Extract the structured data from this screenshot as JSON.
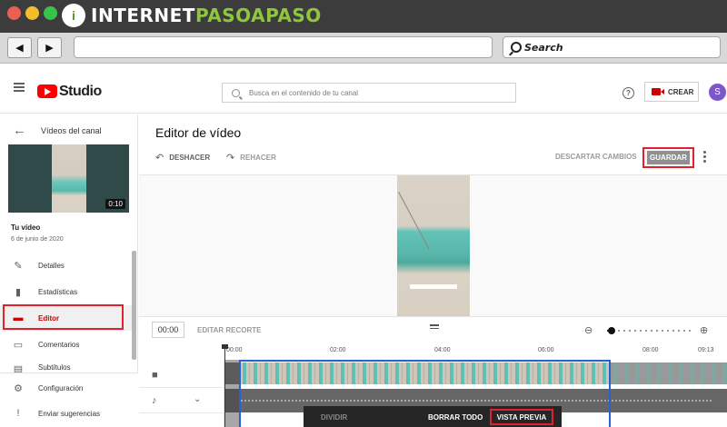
{
  "browser": {
    "brand_a": "INTERNET",
    "brand_b": "PASOAPASO",
    "brand_logo_letter": "i",
    "search_placeholder": "Search",
    "back_glyph": "◀",
    "forward_glyph": "▶"
  },
  "header": {
    "app_name": "Studio",
    "search_placeholder": "Busca en el contenido de tu canal",
    "help_glyph": "?",
    "create_label": "CREAR",
    "avatar_letter": "S"
  },
  "sidebar": {
    "back_label": "Vídeos del canal",
    "thumbnail_duration": "0:10",
    "video_title": "Tu vídeo",
    "video_date": "6 de junio de 2020",
    "items": [
      {
        "label": "Detalles",
        "icon": "pencil-icon"
      },
      {
        "label": "Estadísticas",
        "icon": "bar-chart-icon"
      },
      {
        "label": "Editor",
        "icon": "clapperboard-icon",
        "active": true
      },
      {
        "label": "Comentarios",
        "icon": "comment-icon"
      },
      {
        "label": "Subtítulos",
        "icon": "subtitles-icon"
      }
    ],
    "bottom_items": [
      {
        "label": "Configuración",
        "icon": "gear-icon"
      },
      {
        "label": "Enviar sugerencias",
        "icon": "feedback-icon"
      }
    ]
  },
  "editor": {
    "title": "Editor de vídeo",
    "undo_label": "DESHACER",
    "redo_label": "REHACER",
    "discard_label": "DESCARTAR CAMBIOS",
    "save_label": "GUARDAR"
  },
  "timeline": {
    "current_time": "00:00",
    "edit_trim_label": "EDITAR RECORTE",
    "ticks": [
      "00:00",
      "02:00",
      "04:00",
      "06:00",
      "08:00",
      "09:13"
    ],
    "zoom_level": 0.05
  },
  "action_bar": {
    "split_label": "DIVIDIR",
    "clear_all_label": "BORRAR TODO",
    "preview_label": "VISTA PREVIA"
  },
  "colors": {
    "accent_red": "#e0212e",
    "youtube_red": "#ff0000",
    "trim_blue": "#2463d1",
    "brand_green": "#8ec63f"
  }
}
